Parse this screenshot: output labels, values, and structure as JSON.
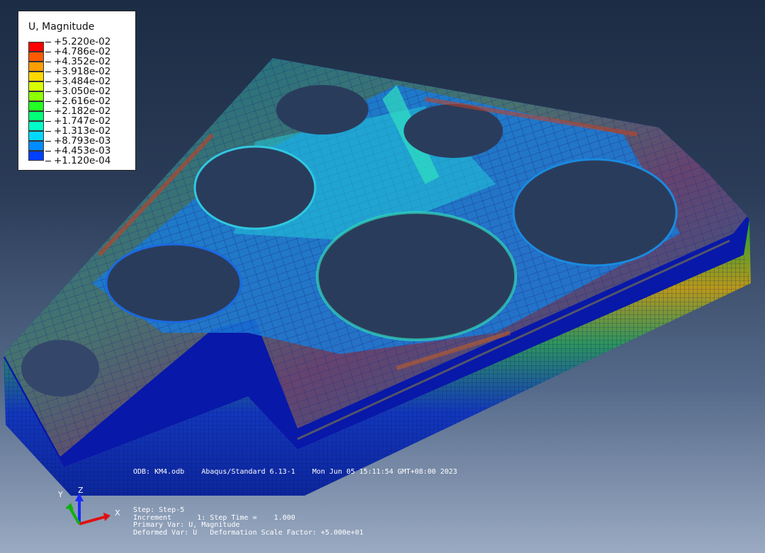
{
  "legend": {
    "title": "U, Magnitude",
    "levels": [
      {
        "label": "+5.220e-02",
        "color": "#ff0000"
      },
      {
        "label": "+4.786e-02",
        "color": "#ff5a00"
      },
      {
        "label": "+4.352e-02",
        "color": "#ff9e00"
      },
      {
        "label": "+3.918e-02",
        "color": "#ffd800"
      },
      {
        "label": "+3.484e-02",
        "color": "#d8ff00"
      },
      {
        "label": "+3.050e-02",
        "color": "#8cff00"
      },
      {
        "label": "+2.616e-02",
        "color": "#22ff22"
      },
      {
        "label": "+2.182e-02",
        "color": "#00ff78"
      },
      {
        "label": "+1.747e-02",
        "color": "#00ffc8"
      },
      {
        "label": "+1.313e-02",
        "color": "#00d8ff"
      },
      {
        "label": "+8.793e-03",
        "color": "#008cff"
      },
      {
        "label": "+4.453e-03",
        "color": "#0040ff"
      },
      {
        "label": "+1.120e-04",
        "color": "#0000ff"
      }
    ]
  },
  "info": {
    "odb_line": "ODB: KM4.odb    Abaqus/Standard 6.13-1    Mon Jun 05 15:11:54 GMT+08:00 2023"
  },
  "step_info": {
    "step": "Step: Step-5",
    "increment": "Increment      1: Step Time =    1.000",
    "primary": "Primary Var: U, Magnitude",
    "deformed": "Deformed Var: U   Deformation Scale Factor: +5.000e+01"
  },
  "triad": {
    "x": "X",
    "y": "Y",
    "z": "Z"
  }
}
